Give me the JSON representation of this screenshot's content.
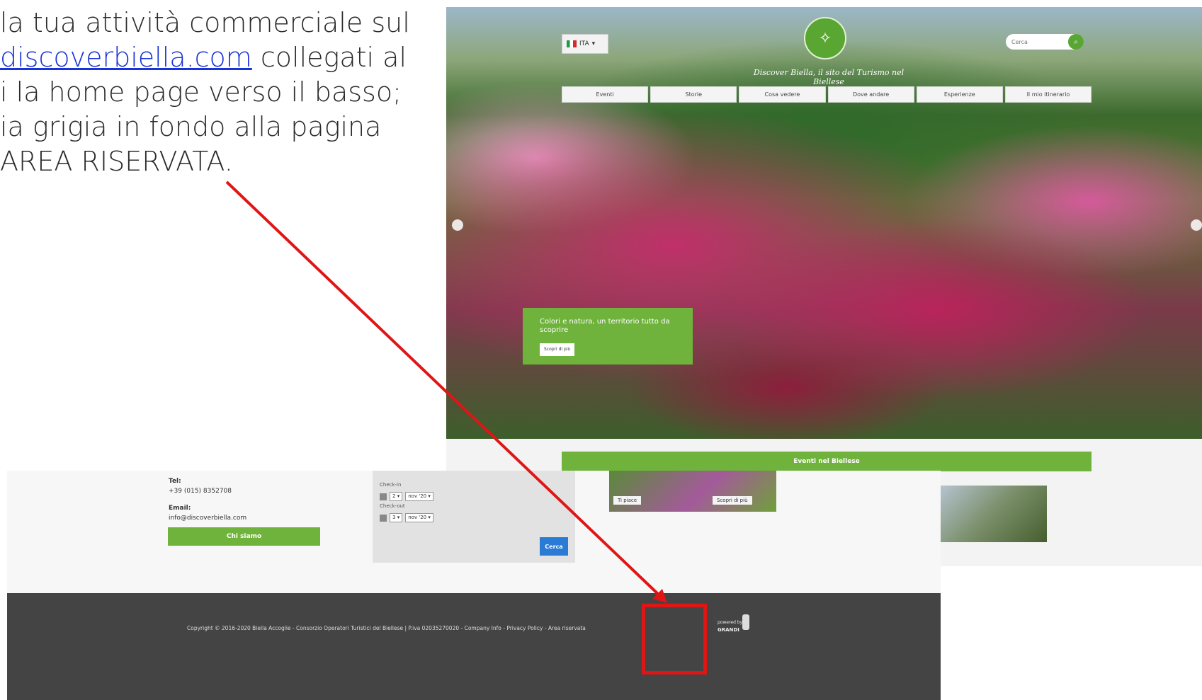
{
  "instructions": {
    "line1": "la tua attività commerciale sul",
    "link": "discoverbiella.com",
    "line2_suffix": " collegati al",
    "line3": "i la home page verso il basso;",
    "line4": "ia grigia in fondo alla pagina",
    "line5": "AREA RISERVATA."
  },
  "homepage": {
    "language": "ITA",
    "tagline": "Discover Biella, il sito del Turismo nel Biellese",
    "search_placeholder": "Cerca",
    "nav": [
      "Eventi",
      "Storie",
      "Cosa vedere",
      "Dove andare",
      "Esperienze",
      "Il mio itinerario"
    ],
    "promo_text": "Colori e natura, un territorio tutto da scoprire",
    "promo_button": "Scopri di più",
    "events_title": "Eventi nel Biellese"
  },
  "footer_page": {
    "tel_label": "Tel:",
    "tel_value": "+39 (015) 8352708",
    "email_label": "Email:",
    "email_value": "info@discoverbiella.com",
    "chi_siamo": "Chi siamo",
    "checkin_label": "Check-in",
    "checkin_day": "2",
    "checkin_month": "nov '20",
    "checkout_label": "Check-out",
    "checkout_day": "3",
    "checkout_month": "nov '20",
    "cerca": "Cerca",
    "card_tag": "Ti piace",
    "card_more": "Scopri di più",
    "copyright": "Copyright © 2016-2020 Biella Accoglie - Consorzio Operatori Turistici del Biellese | P.iva 02035270020 - Company Info - Privacy Policy - Area riservata",
    "grandi_small": "powered by",
    "grandi_word": "GRANDI"
  },
  "colors": {
    "annotation_red": "#e01515",
    "link_blue": "#1a33d6",
    "brand_green": "#6fb33c",
    "footer_dark": "#444444"
  }
}
